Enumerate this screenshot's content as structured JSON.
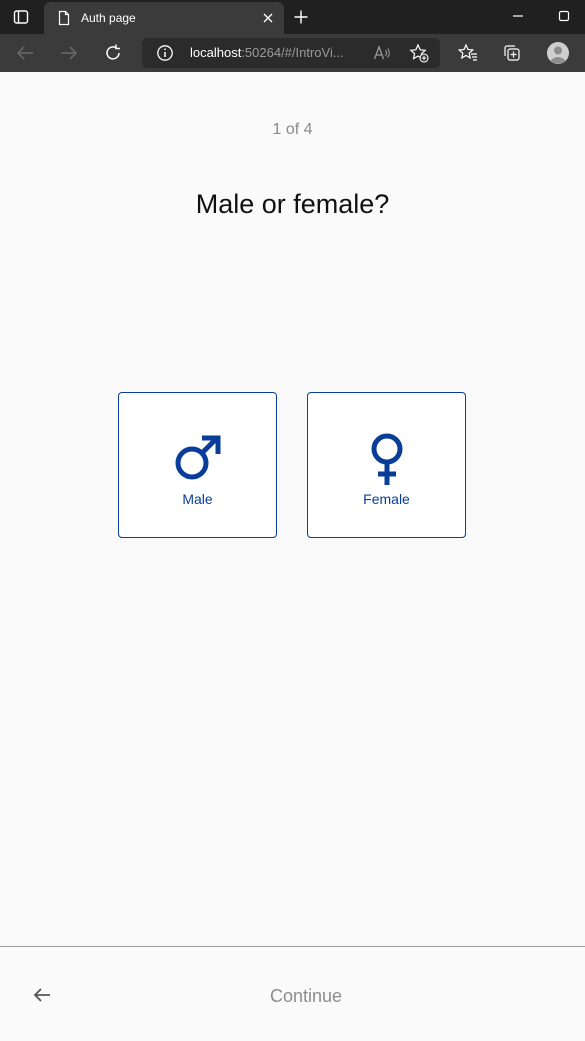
{
  "browser": {
    "tab_title": "Auth page",
    "address_host": "localhost",
    "address_rest": ":50264/#/IntroVi...",
    "icons": [
      "tab-actions-icon",
      "page-icon",
      "close-icon",
      "plus-icon",
      "minimize-icon",
      "maximize-icon",
      "back-arrow-icon",
      "forward-arrow-icon",
      "refresh-icon",
      "info-icon",
      "read-aloud-icon",
      "add-favorite-icon",
      "favorites-icon",
      "collections-icon",
      "profile-icon"
    ]
  },
  "page": {
    "step": "1 of 4",
    "question": "Male or female?",
    "options": [
      {
        "label": "Male",
        "icon": "male-symbol-icon"
      },
      {
        "label": "Female",
        "icon": "female-symbol-icon"
      }
    ],
    "footer": {
      "continue_label": "Continue",
      "back_icon": "arrow-left-icon"
    }
  },
  "colors": {
    "accent": "#0a3d99",
    "chrome_dark": "#202020",
    "chrome_mid": "#3b3b3b",
    "muted_text": "#8c8c8c"
  }
}
